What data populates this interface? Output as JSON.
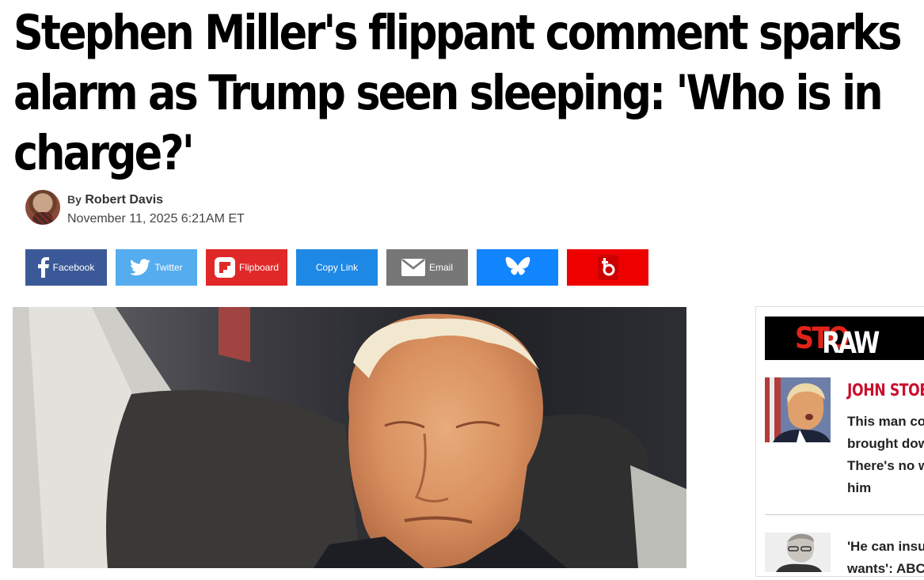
{
  "article": {
    "headline_lines": [
      "Stephen Miller's flippant comment sparks",
      "alarm as Trump seen sleeping: 'Who is in",
      "charge?'"
    ],
    "byline_prefix": "By",
    "author": "Robert Davis",
    "date": "November 11, 2025 6:21AM ET"
  },
  "share": {
    "facebook": "Facebook",
    "twitter": "Twitter",
    "flipboard": "Flipboard",
    "copy_link": "Copy Link",
    "email": "Email"
  },
  "sidebar": {
    "logo_white": "RAW",
    "logo_red": "STO",
    "story1": {
      "kicker": "JOHN STOE",
      "text": "This man co brought dow There's no w him"
    },
    "story2": {
      "text": "'He can insu wants': ABC"
    }
  },
  "colors": {
    "facebook": "#3b5998",
    "twitter": "#55acee",
    "flipboard": "#e12828",
    "copy_link": "#1e88e5",
    "email": "#777777",
    "bluesky": "#1185fe",
    "truth_social": "#ee0000",
    "kicker": "#c8102e"
  },
  "icons": [
    "facebook-icon",
    "twitter-icon",
    "flipboard-icon",
    "email-icon",
    "bluesky-icon",
    "truth-social-icon"
  ]
}
